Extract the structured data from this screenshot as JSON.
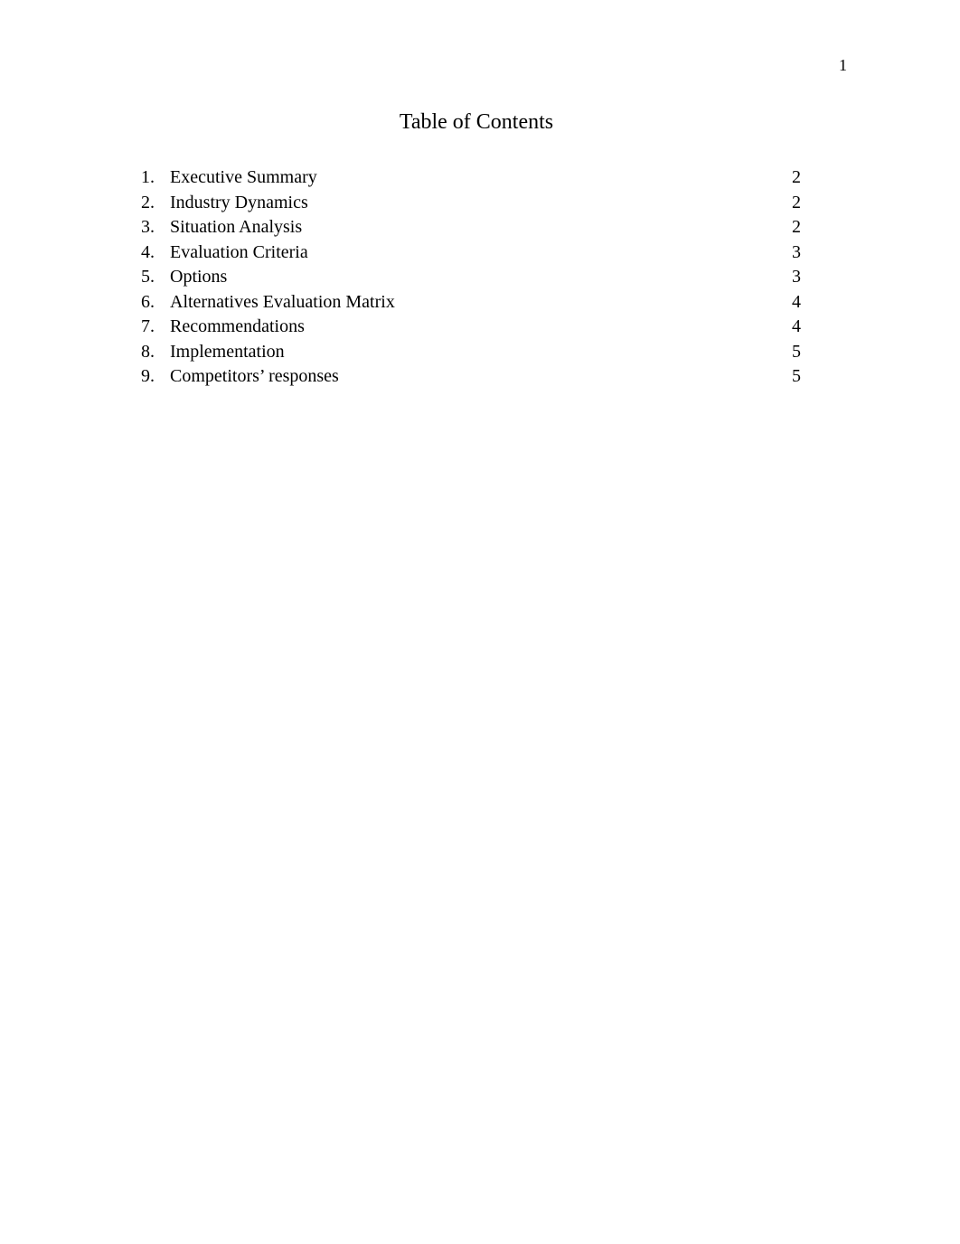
{
  "page_number": "1",
  "title": "Table of Contents",
  "toc": [
    {
      "num": "1.",
      "label": "Executive Summary",
      "page": "2"
    },
    {
      "num": "2.",
      "label": "Industry Dynamics",
      "page": "2"
    },
    {
      "num": "3.",
      "label": "Situation Analysis",
      "page": "2"
    },
    {
      "num": "4.",
      "label": "Evaluation Criteria",
      "page": "3"
    },
    {
      "num": "5.",
      "label": "Options",
      "page": "3"
    },
    {
      "num": "6.",
      "label": "Alternatives Evaluation Matrix",
      "page": "4"
    },
    {
      "num": "7.",
      "label": "Recommendations",
      "page": "4"
    },
    {
      "num": "8.",
      "label": "Implementation",
      "page": "5"
    },
    {
      "num": "9.",
      "label": "Competitors’ responses",
      "page": "5"
    }
  ]
}
